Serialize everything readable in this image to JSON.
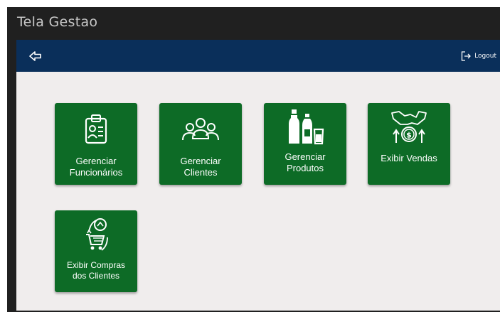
{
  "window": {
    "title": "Tela Gestao"
  },
  "topbar": {
    "logout_label": "Logout"
  },
  "tiles": [
    {
      "line1": "Gerenciar",
      "line2": "Funcionários"
    },
    {
      "line1": "Gerenciar",
      "line2": "Clientes"
    },
    {
      "line1": "Gerenciar",
      "line2": "Produtos"
    },
    {
      "line1": "Exibir Vendas",
      "line2": ""
    },
    {
      "line1": "Exibir Compras",
      "line2": "dos Clientes"
    }
  ],
  "colors": {
    "titlebar": "#202020",
    "topbar": "#0a2f5a",
    "tile": "#0d6b26",
    "background": "#f0eded"
  }
}
